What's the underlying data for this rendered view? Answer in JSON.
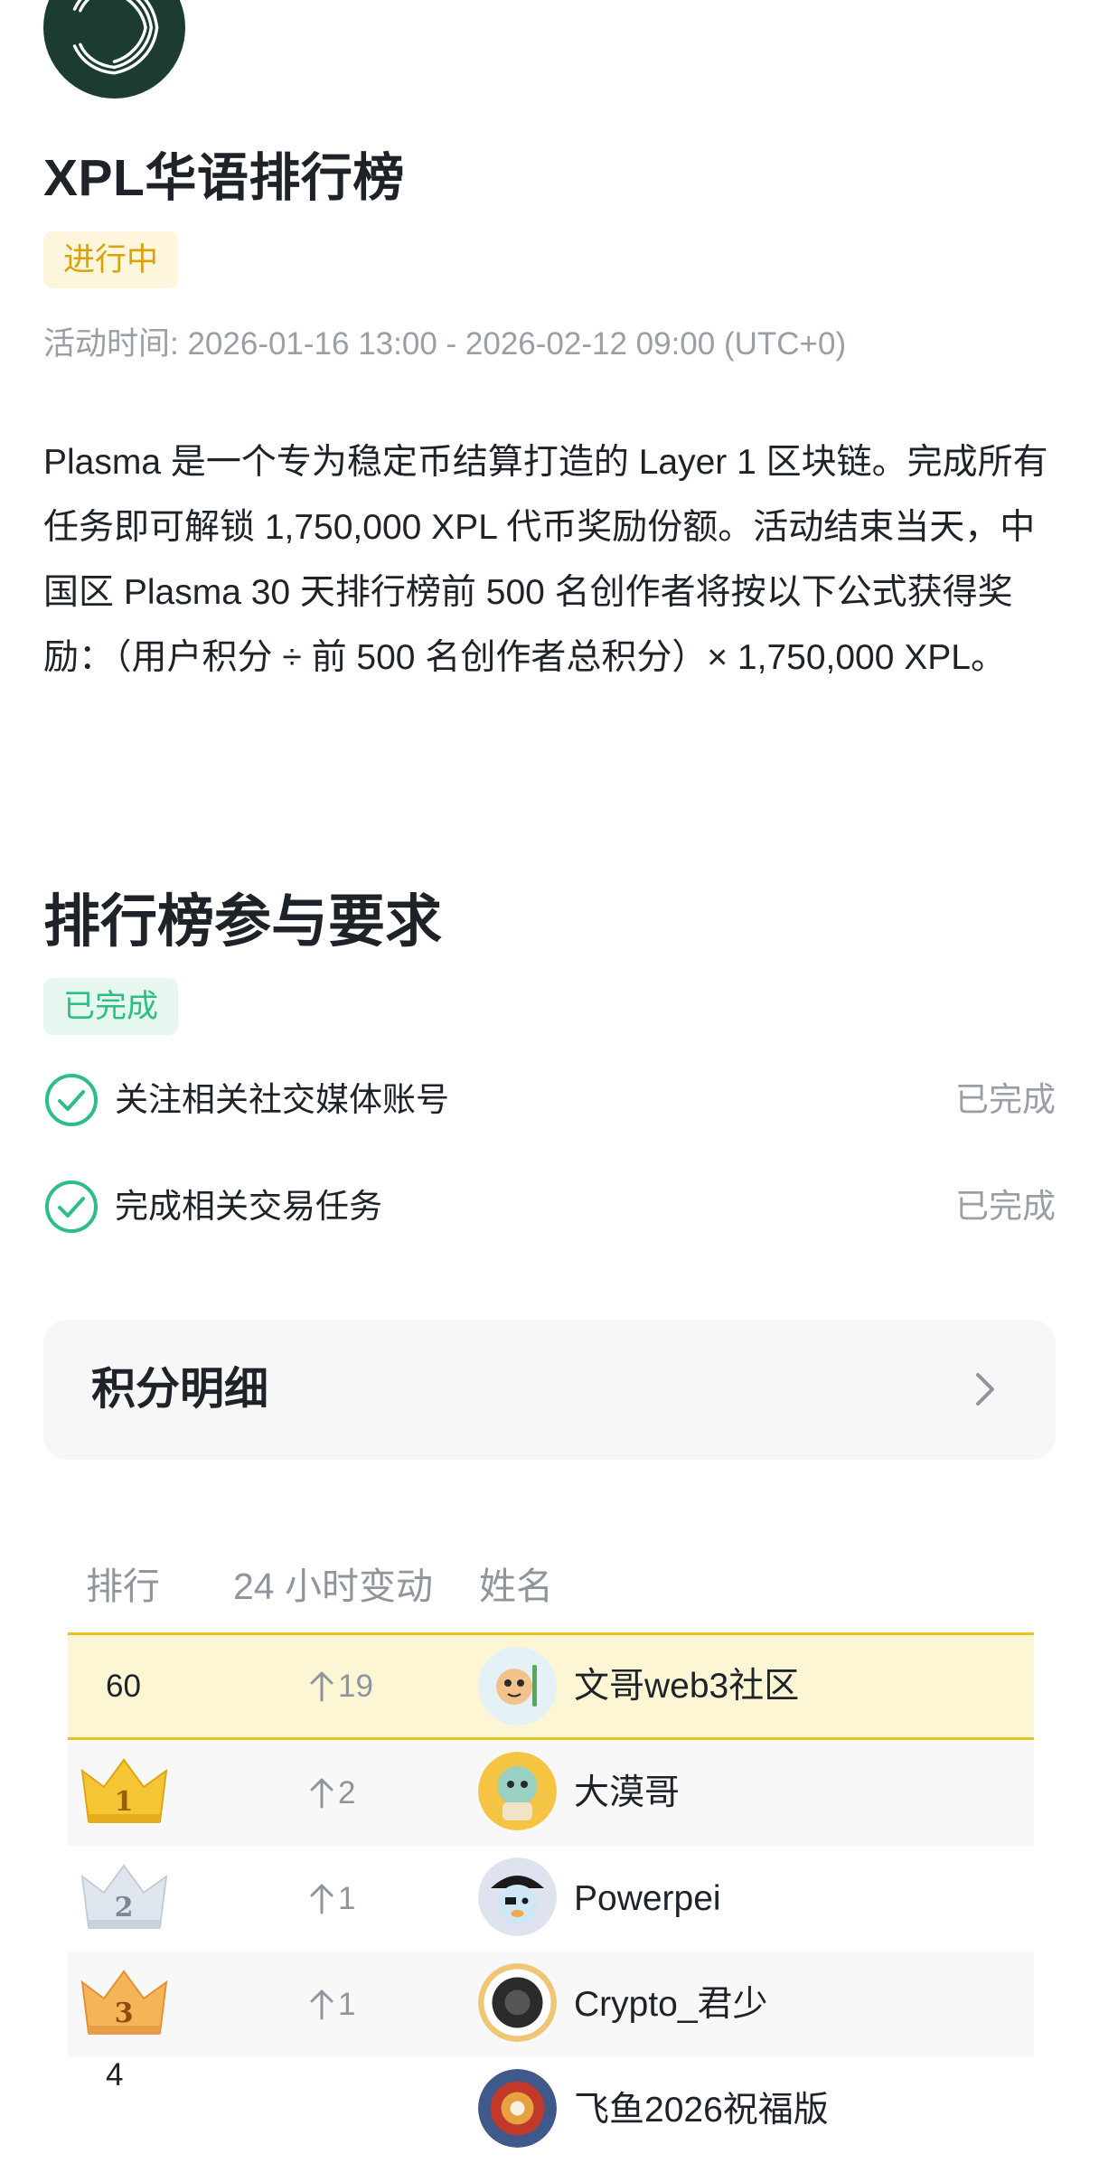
{
  "header": {
    "logo_icon": "plasma-logo-icon",
    "title": "XPL华语排行榜",
    "status_badge": "进行中",
    "time_label": "活动时间: ",
    "time_range": "2026-01-16 13:00 - 2026-02-12 09:00 (UTC+0)",
    "description": "Plasma 是一个专为稳定币结算打造的 Layer 1 区块链。完成所有任务即可解锁 1,750,000 XPL 代币奖励份额。活动结束当天，中国区 Plasma 30 天排行榜前 500 名创作者将按以下公式获得奖励：（用户积分 ÷ 前 500 名创作者总积分）× 1,750,000 XPL。"
  },
  "requirements": {
    "title": "排行榜参与要求",
    "status_badge": "已完成",
    "items": [
      {
        "label": "关注相关社交媒体账号",
        "status": "已完成",
        "icon": "check-circle-icon"
      },
      {
        "label": "完成相关交易任务",
        "status": "已完成",
        "icon": "check-circle-icon"
      }
    ]
  },
  "points_detail": {
    "label": "积分明细",
    "icon": "chevron-right-icon"
  },
  "leaderboard": {
    "columns": [
      "排行",
      "24 小时变动",
      "姓名"
    ],
    "rows": [
      {
        "rank": "60",
        "change": "19",
        "name": "文哥web3社区",
        "highlight": true
      },
      {
        "rank": "1",
        "change": "2",
        "name": "大漠哥",
        "badge": "gold-crown-icon"
      },
      {
        "rank": "2",
        "change": "1",
        "name": "Powerpei",
        "badge": "silver-crown-icon"
      },
      {
        "rank": "3",
        "change": "1",
        "name": "Crypto_君少",
        "badge": "bronze-crown-icon"
      },
      {
        "rank": "4",
        "change": "",
        "name": "飞鱼2026祝福版"
      }
    ]
  },
  "colors": {
    "accent_yellow": "#e8c41a",
    "success_green": "#2ebd85",
    "ongoing_text": "#d9a20b",
    "muted_text": "#9a9fa6",
    "logo_bg": "#1b3b33"
  }
}
